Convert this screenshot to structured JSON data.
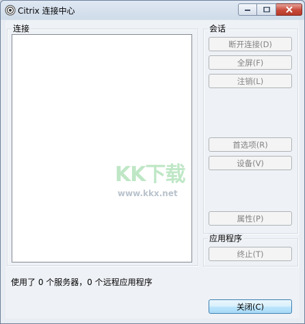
{
  "window": {
    "title": "Citrix 连接中心"
  },
  "connections": {
    "group_label": "连接"
  },
  "session": {
    "group_label": "会话",
    "disconnect": "断开连接(D)",
    "fullscreen": "全屏(F)",
    "logoff": "注销(L)",
    "preferences": "首选项(R)",
    "devices": "设备(V)",
    "properties": "属性(P)"
  },
  "applications": {
    "group_label": "应用程序",
    "terminate": "终止(T)"
  },
  "status": {
    "text": "使用了 0 个服务器，0 个远程应用程序"
  },
  "footer": {
    "close": "关闭(C)"
  },
  "watermark": {
    "logo": "KK下载",
    "url": "www.kkx.net"
  },
  "colors": {
    "enabled_button": "#bee6fd",
    "watermark_green": "#8fd49a",
    "close_red": "#c74a3a"
  }
}
